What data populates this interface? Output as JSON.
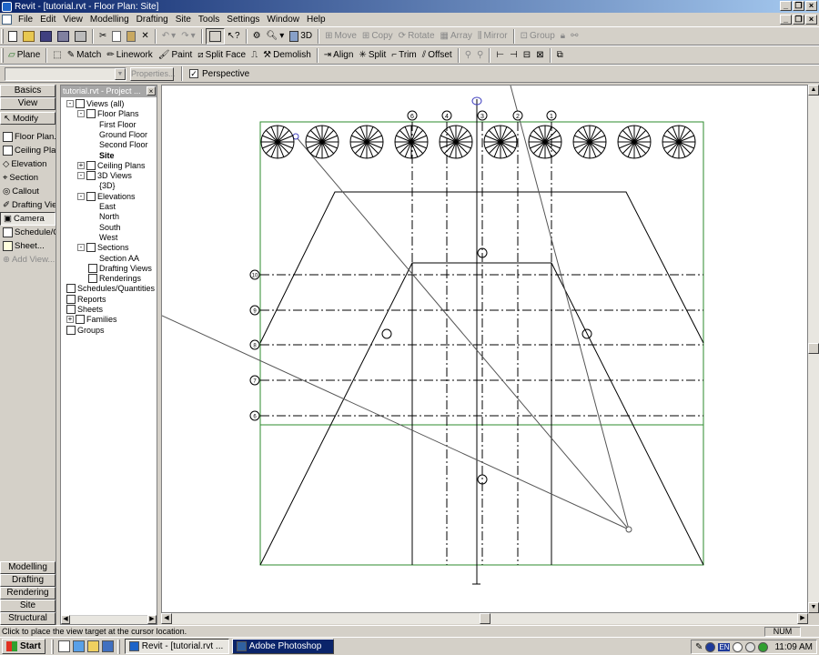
{
  "window": {
    "title": "Revit - [tutorial.rvt - Floor Plan: Site]"
  },
  "menu": [
    "File",
    "Edit",
    "View",
    "Modelling",
    "Drafting",
    "Site",
    "Tools",
    "Settings",
    "Window",
    "Help"
  ],
  "toolbar_main": {
    "view_3d": "3D",
    "move": "Move",
    "copy": "Copy",
    "rotate": "Rotate",
    "array": "Array",
    "mirror": "Mirror",
    "group": "Group"
  },
  "toolbar_edit": {
    "plane": "Plane",
    "match": "Match",
    "linework": "Linework",
    "paint": "Paint",
    "split_face": "Split Face",
    "demolish": "Demolish",
    "align": "Align",
    "split": "Split",
    "trim": "Trim",
    "offset": "Offset"
  },
  "options_bar": {
    "type_selector": "",
    "properties": "Properties...",
    "perspective_label": "Perspective",
    "perspective_checked": true
  },
  "design_bar": {
    "tabs": {
      "basics": "Basics",
      "view": "View"
    },
    "items": [
      {
        "label": "Modify",
        "disabled": false
      },
      {
        "label": "Floor Plan...",
        "disabled": false
      },
      {
        "label": "Ceiling Plan...",
        "disabled": false
      },
      {
        "label": "Elevation",
        "disabled": false
      },
      {
        "label": "Section",
        "disabled": false
      },
      {
        "label": "Callout",
        "disabled": false
      },
      {
        "label": "Drafting View...",
        "disabled": false
      },
      {
        "label": "Camera",
        "disabled": false,
        "selected": true
      },
      {
        "label": "Schedule/Quantities",
        "disabled": false
      },
      {
        "label": "Sheet...",
        "disabled": false
      },
      {
        "label": "Add View...",
        "disabled": true
      }
    ],
    "bottom_tabs": [
      "Modelling",
      "Drafting",
      "Rendering",
      "Site",
      "Structural"
    ]
  },
  "project_browser": {
    "title": "tutorial.rvt - Project ...",
    "tree": [
      {
        "label": "Views (all)",
        "level": 0,
        "toggle": "-"
      },
      {
        "label": "Floor Plans",
        "level": 1,
        "toggle": "-"
      },
      {
        "label": "First Floor",
        "level": 2
      },
      {
        "label": "Ground Floor",
        "level": 2
      },
      {
        "label": "Second Floor",
        "level": 2
      },
      {
        "label": "Site",
        "level": 2,
        "bold": true
      },
      {
        "label": "Ceiling Plans",
        "level": 1,
        "toggle": "+"
      },
      {
        "label": "3D Views",
        "level": 1,
        "toggle": "-"
      },
      {
        "label": "{3D}",
        "level": 2
      },
      {
        "label": "Elevations",
        "level": 1,
        "toggle": "-"
      },
      {
        "label": "East",
        "level": 2
      },
      {
        "label": "North",
        "level": 2
      },
      {
        "label": "South",
        "level": 2
      },
      {
        "label": "West",
        "level": 2
      },
      {
        "label": "Sections",
        "level": 1,
        "toggle": "-"
      },
      {
        "label": "Section AA",
        "level": 2
      },
      {
        "label": "Drafting Views",
        "level": 1
      },
      {
        "label": "Renderings",
        "level": 1
      },
      {
        "label": "Schedules/Quantities",
        "level": 0
      },
      {
        "label": "Reports",
        "level": 0
      },
      {
        "label": "Sheets",
        "level": 0
      },
      {
        "label": "Families",
        "level": 0,
        "toggle": "+"
      },
      {
        "label": "Groups",
        "level": 0
      }
    ]
  },
  "drawing": {
    "grid_bubbles_top": [
      "6",
      "4",
      "3",
      "2",
      "1"
    ],
    "grid_bubbles_left": [
      "10",
      "9",
      "8",
      "7",
      "6"
    ]
  },
  "status_bar": {
    "message": "Click to place the view target at the cursor location.",
    "num": "NUM"
  },
  "taskbar": {
    "start": "Start",
    "tasks": [
      {
        "label": "Revit - [tutorial.rvt ...",
        "active": true
      },
      {
        "label": "Adobe Photoshop",
        "active": false
      }
    ],
    "language": "EN",
    "clock": "11:09 AM"
  }
}
